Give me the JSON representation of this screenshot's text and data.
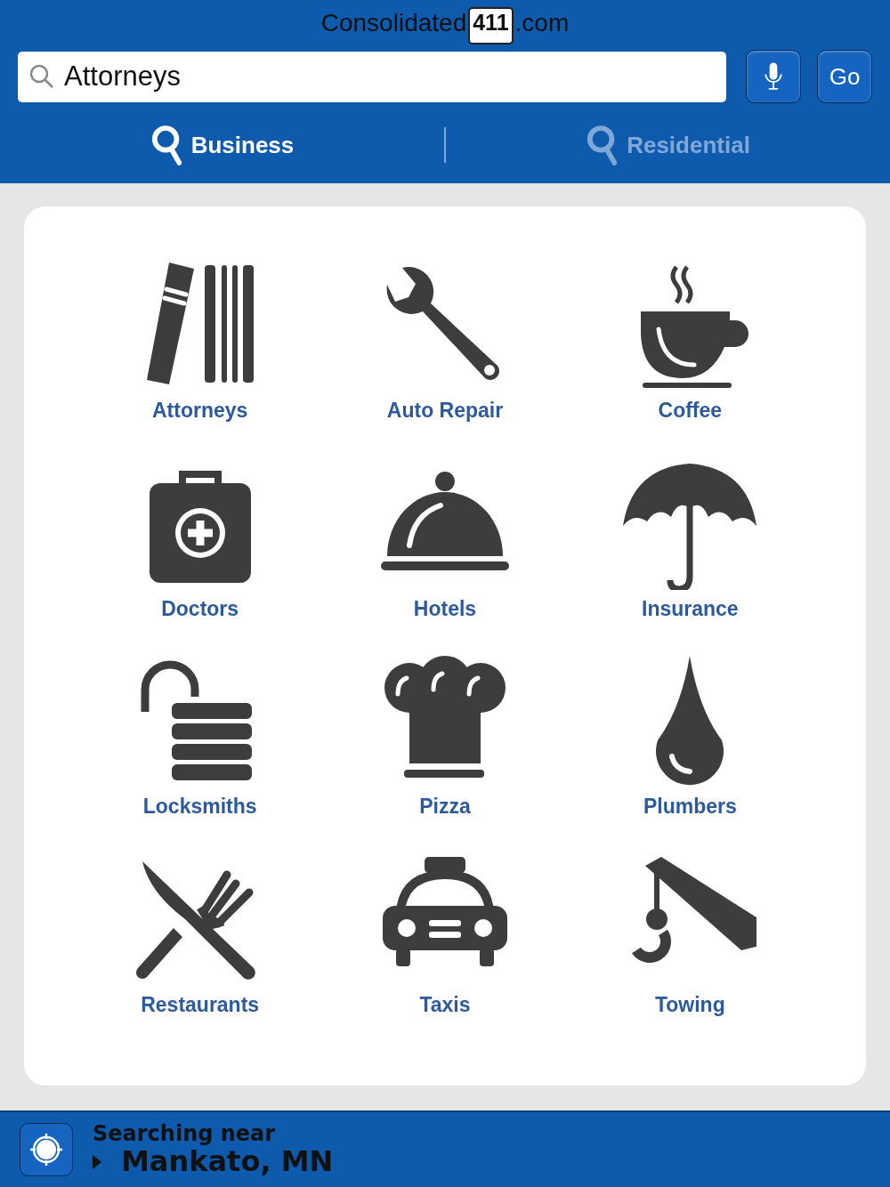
{
  "logo": {
    "before": "Consolidated",
    "badge": "411",
    "after": ".com"
  },
  "search": {
    "value": "Attorneys",
    "go": "Go"
  },
  "tabs": [
    {
      "label": "Business",
      "selected": true
    },
    {
      "label": "Residential",
      "selected": false
    }
  ],
  "categories": [
    {
      "label": "Attorneys",
      "kind": "books"
    },
    {
      "label": "Auto Repair",
      "kind": "wrench"
    },
    {
      "label": "Coffee",
      "kind": "cup"
    },
    {
      "label": "Doctors",
      "kind": "medkit"
    },
    {
      "label": "Hotels",
      "kind": "cloche"
    },
    {
      "label": "Insurance",
      "kind": "umbrella"
    },
    {
      "label": "Locksmiths",
      "kind": "lock"
    },
    {
      "label": "Pizza",
      "kind": "chefhat"
    },
    {
      "label": "Plumbers",
      "kind": "drop"
    },
    {
      "label": "Restaurants",
      "kind": "cutlery"
    },
    {
      "label": "Taxis",
      "kind": "taxi"
    },
    {
      "label": "Towing",
      "kind": "hook"
    }
  ],
  "location": {
    "caption": "Searching near",
    "place": "Mankato, MN"
  }
}
